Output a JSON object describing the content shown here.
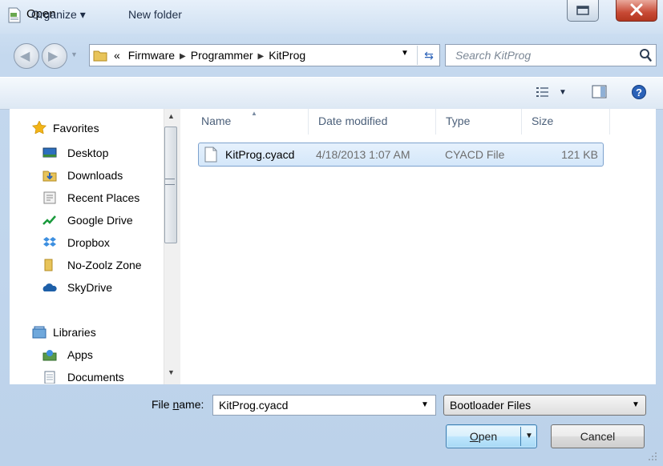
{
  "window": {
    "title": "Open"
  },
  "address_bar": {
    "prefix": "«",
    "crumbs": [
      "Firmware",
      "Programmer",
      "KitProg"
    ]
  },
  "search": {
    "placeholder": "Search KitProg"
  },
  "toolbar": {
    "organize_label": "Organize ▾",
    "new_folder_label": "New folder"
  },
  "nav_pane": {
    "favorites_label": "Favorites",
    "favorites": [
      "Desktop",
      "Downloads",
      "Recent Places",
      "Google Drive",
      "Dropbox",
      "No-Zoolz Zone",
      "SkyDrive"
    ],
    "libraries_label": "Libraries",
    "libraries": [
      "Apps",
      "Documents"
    ]
  },
  "columns": {
    "name": "Name",
    "date": "Date modified",
    "type": "Type",
    "size": "Size"
  },
  "files": [
    {
      "name": "KitProg.cyacd",
      "date": "4/18/2013 1:07 AM",
      "type": "CYACD File",
      "size": "121 KB"
    }
  ],
  "bottom": {
    "file_name_label_pre": "File ",
    "file_name_label_u": "n",
    "file_name_label_post": "ame:",
    "file_name_value": "KitProg.cyacd",
    "file_type_value": "Bootloader Files",
    "open_label_u": "O",
    "open_label_rest": "pen",
    "cancel_label": "Cancel"
  },
  "colors": {
    "accent": "#2b62b8",
    "selection_border": "#7da2ce",
    "close_red": "#c84a35"
  }
}
